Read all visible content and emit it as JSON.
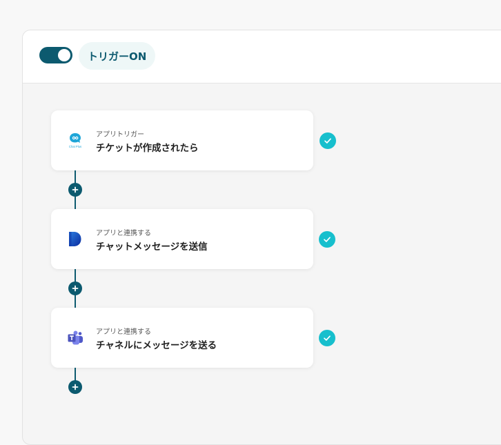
{
  "header": {
    "trigger_toggle_on": true,
    "trigger_label": "トリガーON"
  },
  "steps": [
    {
      "category": "アプリトリガー",
      "title": "チケットが作成されたら",
      "icon": "chatplus-logo-icon",
      "icon_text": "Chat Plus",
      "status": "completed"
    },
    {
      "category": "アプリと連携する",
      "title": "チャットメッセージを送信",
      "icon": "chatwork-d-logo-icon",
      "status": "completed"
    },
    {
      "category": "アプリと連携する",
      "title": "チャネルにメッセージを送る",
      "icon": "microsoft-teams-logo-icon",
      "status": "completed"
    }
  ],
  "colors": {
    "primary": "#0c5a6f",
    "check": "#17bfcd",
    "pill_bg": "#eef7f7",
    "canvas_bg": "#f5f5f5"
  }
}
